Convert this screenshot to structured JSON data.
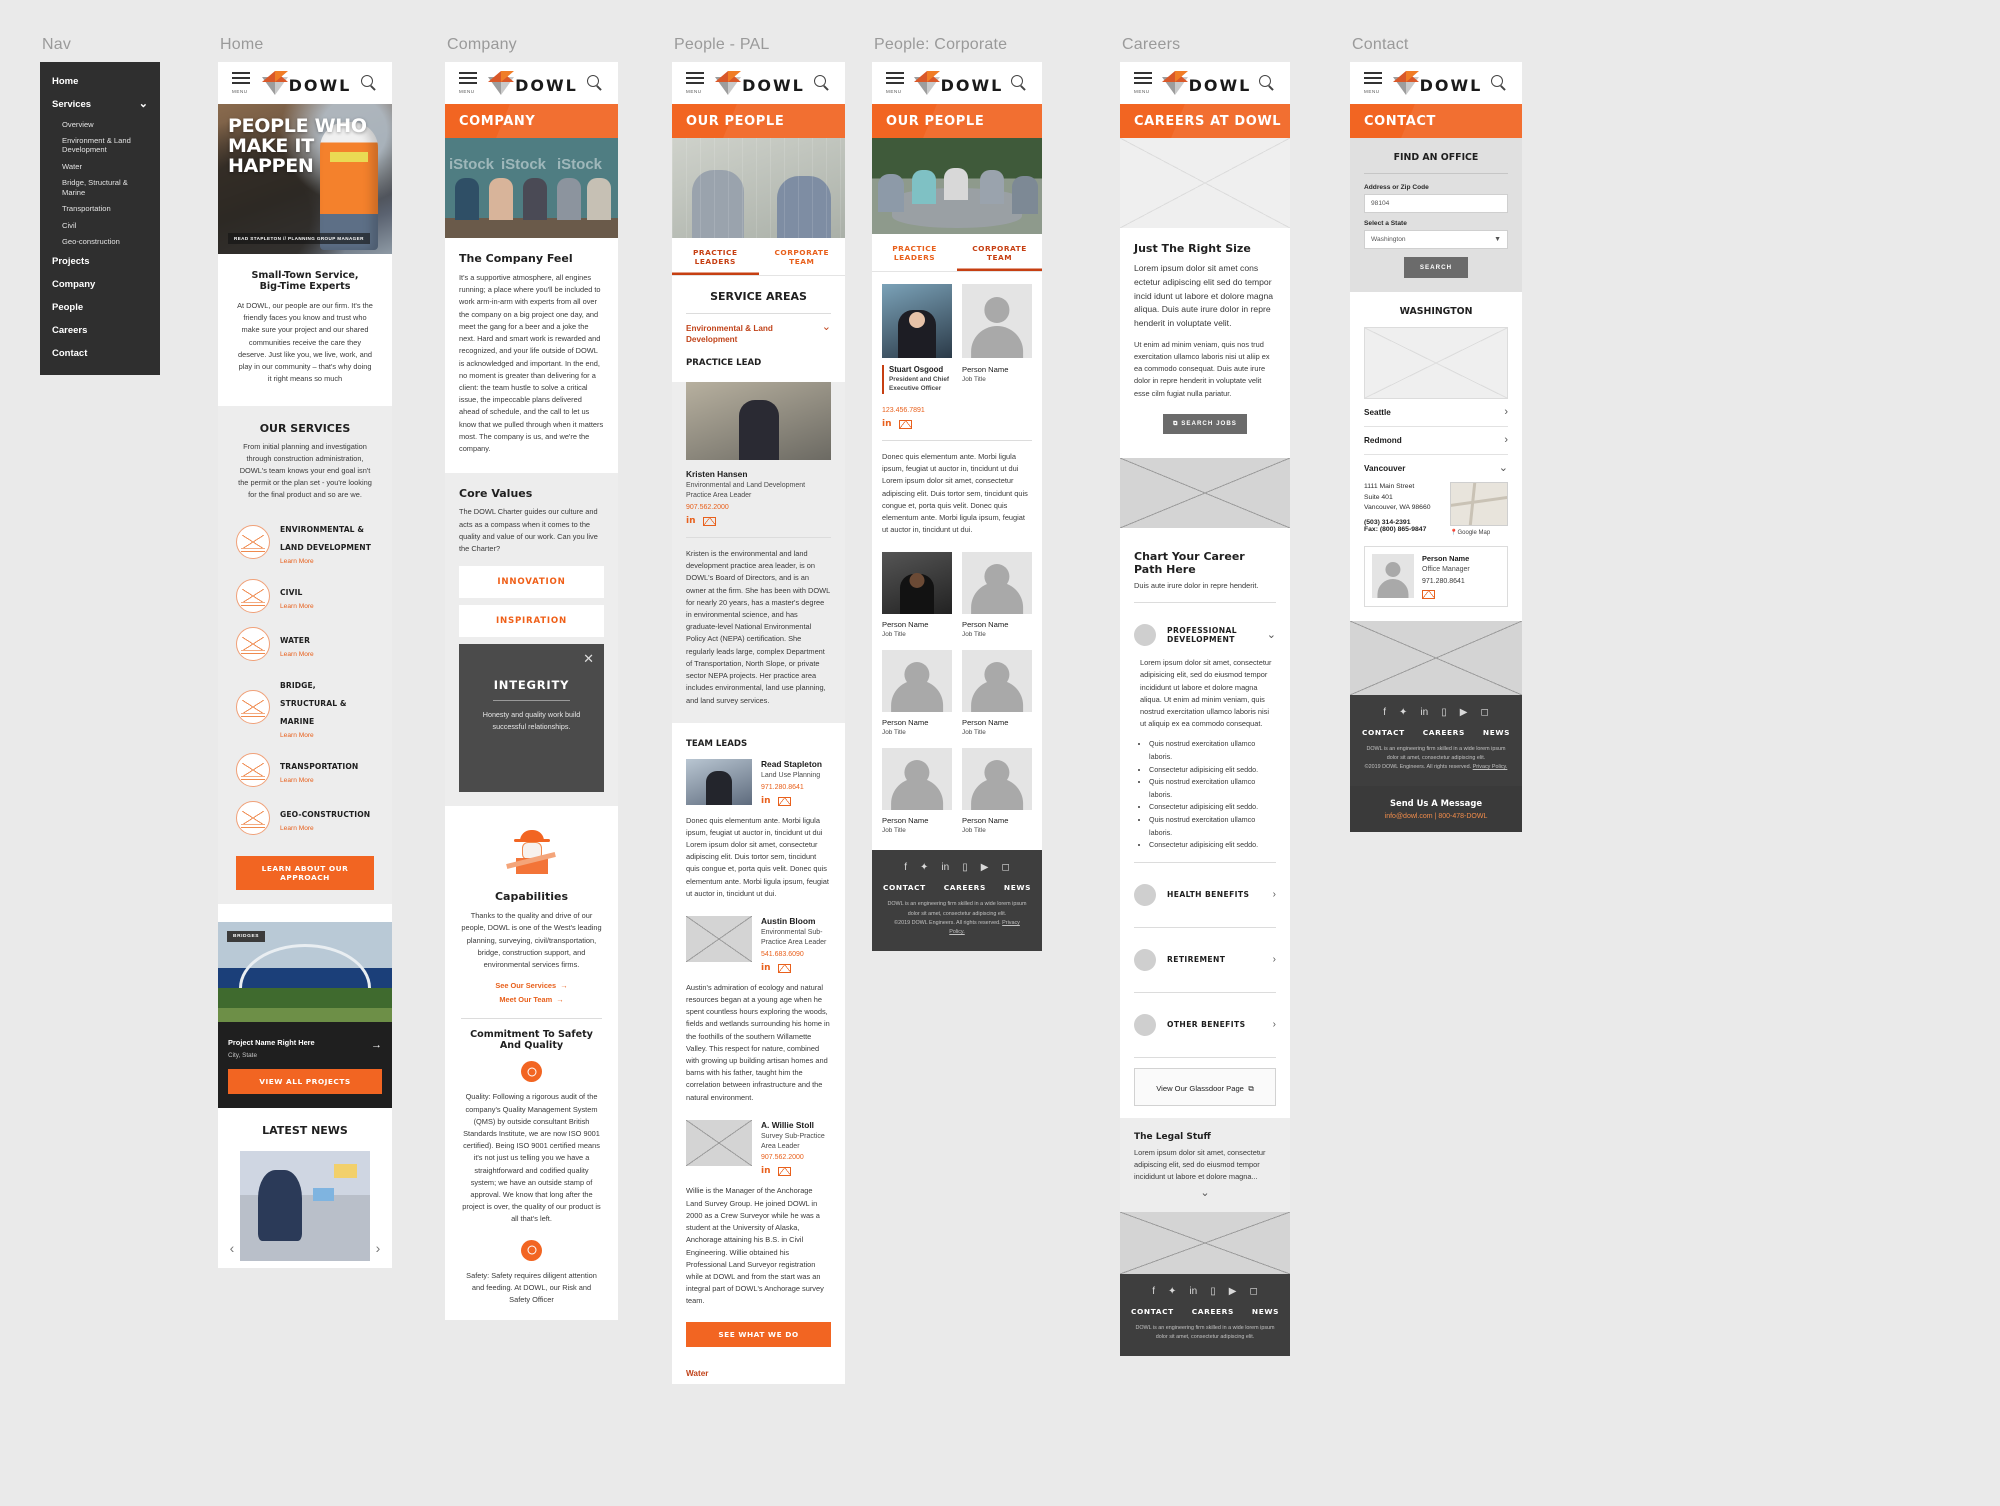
{
  "columns": {
    "nav": "Nav",
    "home": "Home",
    "company": "Company",
    "people_pal": "People - PAL",
    "people_corp": "People: Corporate",
    "careers": "Careers",
    "contact": "Contact"
  },
  "brand": {
    "logo_text": "DOWL",
    "accent": "#f26522",
    "accent_dark": "#c63f12",
    "menu_label": "MENU"
  },
  "nav": {
    "items": [
      {
        "label": "Home",
        "level": 1
      },
      {
        "label": "Services",
        "level": 1,
        "expanded": true
      },
      {
        "label": "Overview",
        "level": 2
      },
      {
        "label": "Environment & Land Development",
        "level": 2
      },
      {
        "label": "Water",
        "level": 2
      },
      {
        "label": "Bridge, Structural & Marine",
        "level": 2
      },
      {
        "label": "Transportation",
        "level": 2
      },
      {
        "label": "Civil",
        "level": 2
      },
      {
        "label": "Geo-construction",
        "level": 2
      },
      {
        "label": "Projects",
        "level": 1
      },
      {
        "label": "Company",
        "level": 1
      },
      {
        "label": "People",
        "level": 1
      },
      {
        "label": "Careers",
        "level": 1
      },
      {
        "label": "Contact",
        "level": 1
      }
    ]
  },
  "home": {
    "hero_headline": "PEOPLE WHO MAKE IT HAPPEN",
    "hero_caption": "READ STAPLETON  //  PLANNING GROUP MANAGER",
    "intro_title_1": "Small-Town Service,",
    "intro_title_2": "Big-Time Experts",
    "intro_body": "At DOWL, our people are our firm. It's the friendly faces you know and trust who make sure your project and our shared communities receive the care they deserve. Just like you, we live, work, and play in our community – that's why doing it right means so much",
    "services_title": "OUR SERVICES",
    "services_body": "From initial planning and investigation through construction administration, DOWL's team knows your end goal isn't the permit or the plan set - you're looking for the final product and so are we.",
    "learn_more": "Learn More",
    "services": [
      {
        "name": "ENVIRONMENTAL & LAND DEVELOPMENT"
      },
      {
        "name": "CIVIL"
      },
      {
        "name": "WATER"
      },
      {
        "name": "BRIDGE, STRUCTURAL & MARINE"
      },
      {
        "name": "TRANSPORTATION"
      },
      {
        "name": "GEO-CONSTRUCTION"
      }
    ],
    "approach_button": "LEARN ABOUT OUR APPROACH",
    "project_tag": "BRIDGES",
    "project_name": "Project Name Right Here",
    "project_city": "City, State",
    "projects_button": "VIEW ALL PROJECTS",
    "news_title": "LATEST NEWS"
  },
  "company": {
    "banner": "COMPANY",
    "image_watermark": "iStock",
    "feel_title": "The Company Feel",
    "feel_body": "It's a supportive atmosphere, all engines running; a place where you'll be included to work arm-in-arm with experts from all over the company on a big project one day, and meet the gang for a beer and a joke the next. Hard and smart work is rewarded and recognized, and your life outside of DOWL is acknowledged and important. In the end, no moment is greater than delivering for a client: the team hustle to solve a critical issue, the impeccable plans delivered ahead of schedule, and the call to let us know that we pulled through when it matters most. The company is us, and we're the company.",
    "core_title": "Core Values",
    "core_body": "The DOWL Charter guides our culture and acts as a compass when it comes to the quality and value of our work. Can you live the Charter?",
    "values": [
      "INNOVATION",
      "INSPIRATION"
    ],
    "open_value": {
      "title": "INTEGRITY",
      "body": "Honesty and quality work build successful relationships."
    },
    "capabilities_title": "Capabilities",
    "capabilities_body": "Thanks to the quality and drive of our people, DOWL is one of the West's leading planning, surveying, civil/transportation, bridge, construction support, and environmental services firms.",
    "cap_link_1": "See Our Services",
    "cap_link_2": "Meet Our Team",
    "safety_title_1": "Commitment To Safety",
    "safety_title_2": "And Quality",
    "quality_body": "Quality: Following a rigorous audit of the company's Quality Management System (QMS) by outside consultant British Standards Institute, we are now ISO 9001 certified). Being ISO 9001 certified means it's not just us telling you we have a straightforward and codified quality system; we have an outside stamp of approval. We know that long after the project is over, the quality of our product is all that's left.",
    "safety_body": "Safety: Safety requires diligent attention and feeding. At DOWL, our Risk and Safety Officer"
  },
  "people_pal": {
    "banner": "OUR PEOPLE",
    "tabs": [
      {
        "label": "PRACTICE LEADERS",
        "active": true
      },
      {
        "label": "CORPORATE TEAM",
        "active": false
      }
    ],
    "service_areas_title": "SERVICE AREAS",
    "service_area_open": "Environmental & Land Development",
    "practice_lead_title": "PRACTICE LEAD",
    "lead": {
      "name": "Kristen Hansen",
      "title": "Environmental and Land Development Practice Area Leader",
      "phone": "907.562.2000",
      "bio": "Kristen is the environmental and land development practice area leader, is on DOWL's Board of Directors, and is an owner at the firm. She has been with DOWL for nearly 20 years, has a master's degree in environmental science, and has graduate-level National Environmental Policy Act (NEPA) certification. She regularly leads large, complex Department of Transportation, North Slope, or private sector NEPA projects. Her practice area includes environmental, land use planning, and land survey services."
    },
    "team_leads_title": "TEAM LEADS",
    "team": [
      {
        "name": "Read Stapleton",
        "title": "Land Use Planning",
        "phone": "971.280.8641",
        "bio": "Donec quis elementum ante. Morbi ligula ipsum, feugiat ut auctor in, tincidunt ut dui Lorem ipsum dolor sit amet, consectetur adipiscing elit. Duis tortor sem, tincidunt quis congue et, porta quis velit. Donec quis elementum ante. Morbi ligula ipsum, feugiat ut auctor in, tincidunt ut dui.",
        "has_photo": true
      },
      {
        "name": "Austin Bloom",
        "title": "Environmental Sub-Practice Area Leader",
        "phone": "541.683.6090",
        "bio": "Austin's admiration of ecology and natural resources began at a young age when he spent countless hours exploring the woods, fields and wetlands surrounding his home in the foothills of the southern Willamette Valley. This respect for nature, combined with growing up building artisan homes and barns with his father, taught him the correlation between infrastructure and the natural environment.",
        "has_photo": false
      },
      {
        "name": "A. Willie Stoll",
        "title": "Survey Sub-Practice Area Leader",
        "phone": "907.562.2000",
        "bio": "Willie is the Manager of the Anchorage Land Survey Group. He joined DOWL in 2000 as a Crew Surveyor while he was a student at the University of Alaska, Anchorage attaining his B.S. in Civil Engineering. Willie obtained his Professional Land Surveyor registration while at DOWL and from the start was an integral part of DOWL's Anchorage survey team.",
        "has_photo": false
      }
    ],
    "cta_button": "SEE WHAT WE DO",
    "next_area": "Water"
  },
  "people_corp": {
    "banner": "OUR PEOPLE",
    "tabs": [
      {
        "label": "PRACTICE LEADERS",
        "active": false
      },
      {
        "label": "CORPORATE TEAM",
        "active": true
      }
    ],
    "featured": {
      "name": "Stuart Osgood",
      "title": "President and Chief Executive Officer",
      "phone": "123.456.7891",
      "bio": "Donec quis elementum ante. Morbi ligula ipsum, feugiat ut auctor in, tincidunt ut dui Lorem ipsum dolor sit amet, consectetur adipiscing elit. Duis tortor sem, tincidunt quis congue et, porta quis velit. Donec quis elementum ante. Morbi ligula ipsum, feugiat ut auctor in, tincidunt ut dui."
    },
    "placeholder_name": "Person Name",
    "placeholder_title": "Job Title",
    "grid_count": 7
  },
  "careers": {
    "banner": "CAREERS AT DOWL",
    "size_title": "Just The Right Size",
    "size_lead": "Lorem ipsum dolor sit amet cons ectetur adipiscing elit sed do tempor incid idunt ut labore et dolore magna aliqua. Duis aute irure dolor in repre henderit in voluptate velit.",
    "size_body": "Ut enim ad minim veniam, quis nos trud exercitation ullamco laboris nisi ut aliip ex ea commodo consequat. Duis aute irure dolor in repre henderit in voluptate velit esse cilm fugiat nulla pariatur.",
    "search_jobs": "SEARCH JOBS",
    "path_title": "Chart Your Career Path Here",
    "path_sub": "Duis aute irure dolor in repre henderit.",
    "accordion": [
      {
        "label": "PROFESSIONAL DEVELOPMENT",
        "open": true
      },
      {
        "label": "HEALTH BENEFITS",
        "open": false
      },
      {
        "label": "RETIREMENT",
        "open": false
      },
      {
        "label": "OTHER BENEFITS",
        "open": false
      }
    ],
    "pd_body": "Lorem ipsum dolor sit amet, consectetur adipisicing elit, sed do eiusmod tempor incididunt ut labore et dolore magna aliqua. Ut enim ad minim veniam, quis nostrud exercitation ullamco laboris nisi ut aliquip ex ea commodo consequat.",
    "pd_bullets": [
      "Quis nostrud exercitation ullamco laboris.",
      "Consectetur adipisicing elit seddo.",
      "Quis nostrud exercitation ullamco laboris.",
      "Consectetur adipisicing elit seddo.",
      "Quis nostrud exercitation ullamco laboris.",
      "Consectetur adipisicing elit seddo."
    ],
    "glassdoor_button": "View Our Glassdoor Page",
    "legal_title": "The Legal Stuff",
    "legal_body": "Lorem ipsum dolor sit amet, consectetur adipiscing elit, sed do eiusmod tempor incididunt ut labore et dolore magna..."
  },
  "contact": {
    "banner": "CONTACT",
    "find_title": "FIND AN OFFICE",
    "zip_label": "Address or Zip Code",
    "zip_value": "98104",
    "state_label": "Select a State",
    "state_value": "Washington",
    "search_button": "SEARCH",
    "state_heading": "WASHINGTON",
    "offices": [
      {
        "name": "Seattle",
        "open": false
      },
      {
        "name": "Redmond",
        "open": false
      },
      {
        "name": "Vancouver",
        "open": true
      }
    ],
    "open_office": {
      "address_1": "1111 Main Street",
      "address_2": "Suite 401",
      "address_3": "Vancouver, WA 98660",
      "phone": "(503) 314-2391",
      "fax": "Fax: (800) 865-9847",
      "map_link": "Google Map"
    },
    "office_contact": {
      "name": "Person Name",
      "title": "Office Manager",
      "phone": "971.280.8641"
    },
    "send_title": "Send Us A Message",
    "send_link": "info@dowl.com  |  800-478-DOWL"
  },
  "footer": {
    "links": [
      "CONTACT",
      "CAREERS",
      "NEWS"
    ],
    "copy_1": "DOWL is an engineering firm skilled in a wide lorem ipsum dolor sit amet, consectetur adipiscing elit.",
    "copy_2": "©2019 DOWL Engineers. All rights reserved.",
    "privacy": "Privacy Policy.",
    "social": [
      "facebook-icon",
      "twitter-icon",
      "linkedin-icon",
      "glassdoor-icon",
      "youtube-icon",
      "instagram-icon"
    ]
  }
}
